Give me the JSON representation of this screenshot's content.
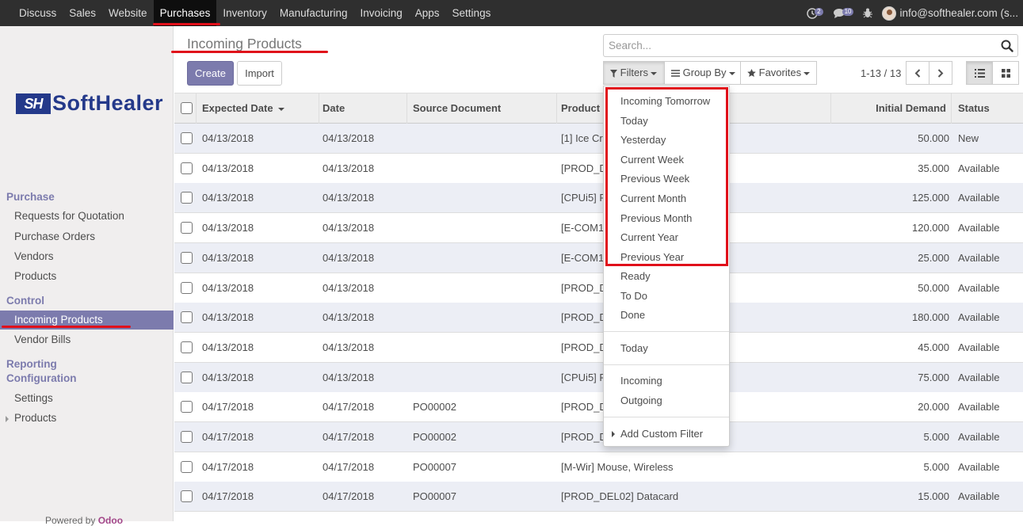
{
  "topbar": {
    "menu": [
      "Discuss",
      "Sales",
      "Website",
      "Purchases",
      "Inventory",
      "Manufacturing",
      "Invoicing",
      "Apps",
      "Settings"
    ],
    "active_menu": "Purchases",
    "activity_count": "2",
    "messages_count": "10",
    "user_email": "info@softhealer.com (s..."
  },
  "sidebar": {
    "logo_mark": "SH",
    "logo_text": "SoftHealer",
    "sections": [
      {
        "title": "Purchase",
        "items": [
          "Requests for Quotation",
          "Purchase Orders",
          "Vendors",
          "Products"
        ]
      },
      {
        "title": "Control",
        "items": [
          "Incoming Products",
          "Vendor Bills"
        ]
      },
      {
        "title": "Reporting",
        "items": []
      },
      {
        "title": "Configuration",
        "items": [
          "Settings",
          "Products"
        ]
      }
    ],
    "active_item": "Incoming Products",
    "powered_by": "Powered by",
    "powered_brand": "Odoo"
  },
  "control": {
    "breadcrumb": "Incoming Products",
    "create_label": "Create",
    "import_label": "Import",
    "search_placeholder": "Search...",
    "filters_label": "Filters",
    "groupby_label": "Group By",
    "favorites_label": "Favorites",
    "pager": "1-13 / 13"
  },
  "table": {
    "columns": [
      "Expected Date",
      "Date",
      "Source Document",
      "Product",
      "Initial Demand",
      "Status"
    ],
    "rows": [
      [
        "04/13/2018",
        "04/13/2018",
        "",
        "[1] Ice Cr",
        "50.000",
        "New"
      ],
      [
        "04/13/2018",
        "04/13/2018",
        "",
        "[PROD_DE",
        "35.000",
        "Available"
      ],
      [
        "04/13/2018",
        "04/13/2018",
        "",
        "[CPUi5] P",
        "125.000",
        "Available"
      ],
      [
        "04/13/2018",
        "04/13/2018",
        "",
        "[E-COM1",
        "120.000",
        "Available"
      ],
      [
        "04/13/2018",
        "04/13/2018",
        "",
        "[E-COM1",
        "25.000",
        "Available"
      ],
      [
        "04/13/2018",
        "04/13/2018",
        "",
        "[PROD_DE",
        "50.000",
        "Available"
      ],
      [
        "04/13/2018",
        "04/13/2018",
        "",
        "[PROD_DE",
        "180.000",
        "Available"
      ],
      [
        "04/13/2018",
        "04/13/2018",
        "",
        "[PROD_DE",
        "45.000",
        "Available"
      ],
      [
        "04/13/2018",
        "04/13/2018",
        "",
        "[CPUi5] P",
        "75.000",
        "Available"
      ],
      [
        "04/17/2018",
        "04/17/2018",
        "PO00002",
        "[PROD_DE",
        "20.000",
        "Available"
      ],
      [
        "04/17/2018",
        "04/17/2018",
        "PO00002",
        "[PROD_DE",
        "5.000",
        "Available"
      ],
      [
        "04/17/2018",
        "04/17/2018",
        "PO00007",
        "[M-Wir] Mouse, Wireless",
        "5.000",
        "Available"
      ],
      [
        "04/17/2018",
        "04/17/2018",
        "PO00007",
        "[PROD_DEL02] Datacard",
        "15.000",
        "Available"
      ]
    ]
  },
  "filters_dropdown": {
    "date_filters": [
      "Incoming Tomorrow",
      "Today",
      "Yesterday",
      "Current Week",
      "Previous Week",
      "Current Month",
      "Previous Month",
      "Current Year",
      "Previous Year"
    ],
    "state_filters": [
      "Ready",
      "To Do",
      "Done"
    ],
    "day_filters": [
      "Today"
    ],
    "direction_filters": [
      "Incoming",
      "Outgoing"
    ],
    "custom_filter": "Add Custom Filter"
  },
  "colors": {
    "accent": "#7c7bad",
    "topbar": "#2f2f2f",
    "highlight_annotation": "#e0101a",
    "logo": "#24398a"
  }
}
